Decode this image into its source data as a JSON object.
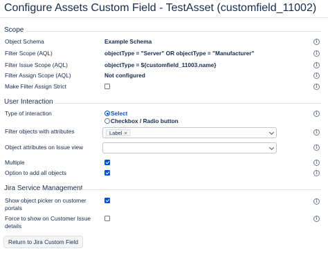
{
  "page": {
    "title": "Configure Assets Custom Field - TestAsset (customfield_11002)",
    "return_button": "Return to Jira Custom Field"
  },
  "sections": {
    "scope": "Scope",
    "user_interaction": "User Interaction",
    "jsm": "Jira Service Management"
  },
  "scope": {
    "object_schema": {
      "label": "Object Schema",
      "value": "Example Schema"
    },
    "filter_scope": {
      "label": "Filter Scope (AQL)",
      "value": "objectType = \"Server\" OR objectType = \"Manufacturer\""
    },
    "filter_issue_scope": {
      "label": "Filter Issue Scope (AQL)",
      "value": "objectType = ${customfield_11003.name}"
    },
    "filter_assign_scope": {
      "label": "Filter Assign Scope (AQL)",
      "value": "Not configured"
    },
    "make_filter_assign_strict": {
      "label": "Make Filter Assign Strict",
      "checked": false
    }
  },
  "user_interaction": {
    "type_of_interaction": {
      "label": "Type of interaction",
      "options": [
        "Select",
        "Checkbox / Radio button"
      ],
      "selected": "Select"
    },
    "filter_objects_with_attributes": {
      "label": "Filter objects with attributes",
      "tags": [
        "Label"
      ]
    },
    "object_attributes_on_issue_view": {
      "label": "Object attributes on Issue view",
      "value": ""
    },
    "multiple": {
      "label": "Multiple",
      "checked": true
    },
    "option_add_all": {
      "label": "Option to add all objects",
      "checked": true
    }
  },
  "jsm": {
    "show_object_picker": {
      "label_line1": "Show object picker on customer",
      "label_line2": "portals",
      "checked": true
    },
    "force_show": {
      "label_line1": "Force to show on Customer Issue",
      "label_line2": "details",
      "checked": false
    }
  },
  "icons": {
    "info": "info-icon",
    "chevron": "chevron-down-icon",
    "remove": "remove-tag-icon"
  },
  "colors": {
    "accent": "#0052cc",
    "text": "#172b4d",
    "rule": "#dfe1e6"
  }
}
